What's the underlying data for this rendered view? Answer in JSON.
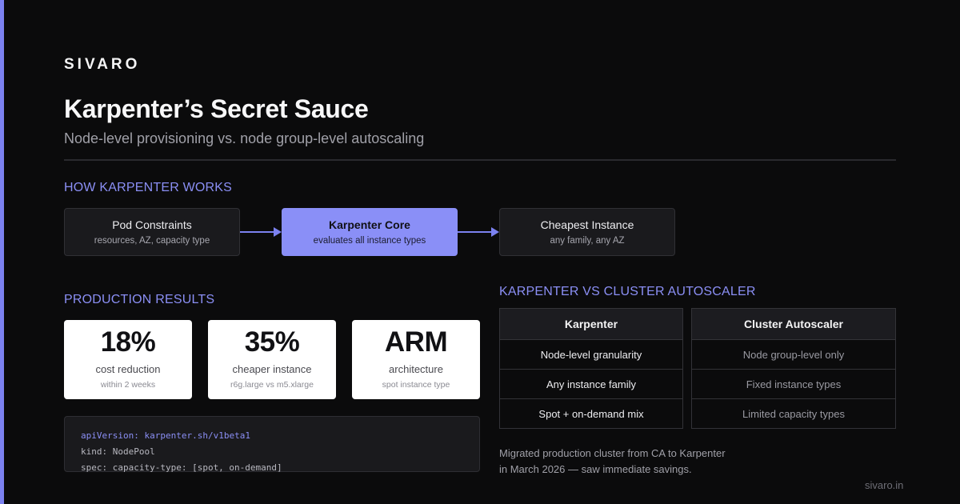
{
  "brand": "SIVARO",
  "title": "Karpenter’s Secret Sauce",
  "subtitle": "Node-level provisioning vs. node group-level autoscaling",
  "how_section": {
    "label": "HOW KARPENTER WORKS",
    "steps": [
      {
        "title": "Pod Constraints",
        "sub": "resources, AZ, capacity type"
      },
      {
        "title": "Karpenter Core",
        "sub": "evaluates all instance types"
      },
      {
        "title": "Cheapest Instance",
        "sub": "any family, any AZ"
      }
    ]
  },
  "results_section": {
    "label": "PRODUCTION RESULTS",
    "stats": [
      {
        "value": "18%",
        "label": "cost reduction",
        "sub": "within 2 weeks"
      },
      {
        "value": "35%",
        "label": "cheaper instance",
        "sub": "r6g.large vs m5.xlarge"
      },
      {
        "value": "ARM",
        "label": "architecture",
        "sub": "spot instance type"
      }
    ]
  },
  "code": {
    "line1_key": "apiVersion:",
    "line1_val": "karpenter.sh/v1beta1",
    "line2": "kind: NodePool",
    "line3": "spec: capacity-type: [spot, on-demand]"
  },
  "comparison": {
    "label": "KARPENTER VS CLUSTER AUTOSCALER",
    "karpenter": {
      "header": "Karpenter",
      "rows": [
        "Node-level granularity",
        "Any instance family",
        "Spot + on-demand mix"
      ]
    },
    "autoscaler": {
      "header": "Cluster Autoscaler",
      "rows": [
        "Node group-level only",
        "Fixed instance types",
        "Limited capacity types"
      ]
    }
  },
  "note": {
    "line1": "Migrated production cluster from CA to Karpenter",
    "line2": "in March 2026 — saw immediate savings."
  },
  "footer_url": "sivaro.in",
  "colors": {
    "accent": "#7c82f0",
    "core_box": "#8a8ff7",
    "background": "#0b0b0c"
  }
}
